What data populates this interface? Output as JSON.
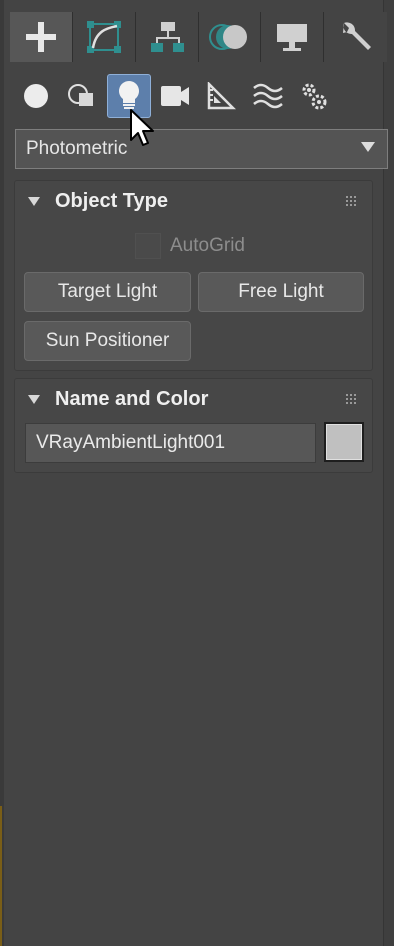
{
  "top_tabs": [
    {
      "name": "create",
      "icon": "plus-icon",
      "active": true
    },
    {
      "name": "modify",
      "icon": "modify-curve-icon",
      "active": false
    },
    {
      "name": "hierarchy",
      "icon": "hierarchy-icon",
      "active": false
    },
    {
      "name": "motion",
      "icon": "motion-icon",
      "active": false
    },
    {
      "name": "display",
      "icon": "display-monitor-icon",
      "active": false
    },
    {
      "name": "utilities",
      "icon": "wrench-icon",
      "active": false
    }
  ],
  "categories": [
    {
      "name": "geometry",
      "icon": "sphere-icon",
      "active": false
    },
    {
      "name": "shapes",
      "icon": "shapes-icon",
      "active": false
    },
    {
      "name": "lights",
      "icon": "lightbulb-icon",
      "active": true
    },
    {
      "name": "cameras",
      "icon": "camera-icon",
      "active": false
    },
    {
      "name": "helpers",
      "icon": "helper-triangle-icon",
      "active": false
    },
    {
      "name": "space-warps",
      "icon": "spacewarp-icon",
      "active": false
    },
    {
      "name": "systems",
      "icon": "systems-gears-icon",
      "active": false
    }
  ],
  "dropdown": {
    "selected": "Photometric"
  },
  "object_type": {
    "title": "Object Type",
    "autogrid_label": "AutoGrid",
    "autogrid_checked": false,
    "buttons": [
      "Target Light",
      "Free Light",
      "Sun Positioner"
    ]
  },
  "name_and_color": {
    "title": "Name and Color",
    "name_value": "VRayAmbientLight001",
    "color": "#c0c0c0"
  },
  "colors": {
    "accent": "#5d7fab",
    "teal_icon": "#2f8f8f",
    "panel_bg": "#444444"
  }
}
